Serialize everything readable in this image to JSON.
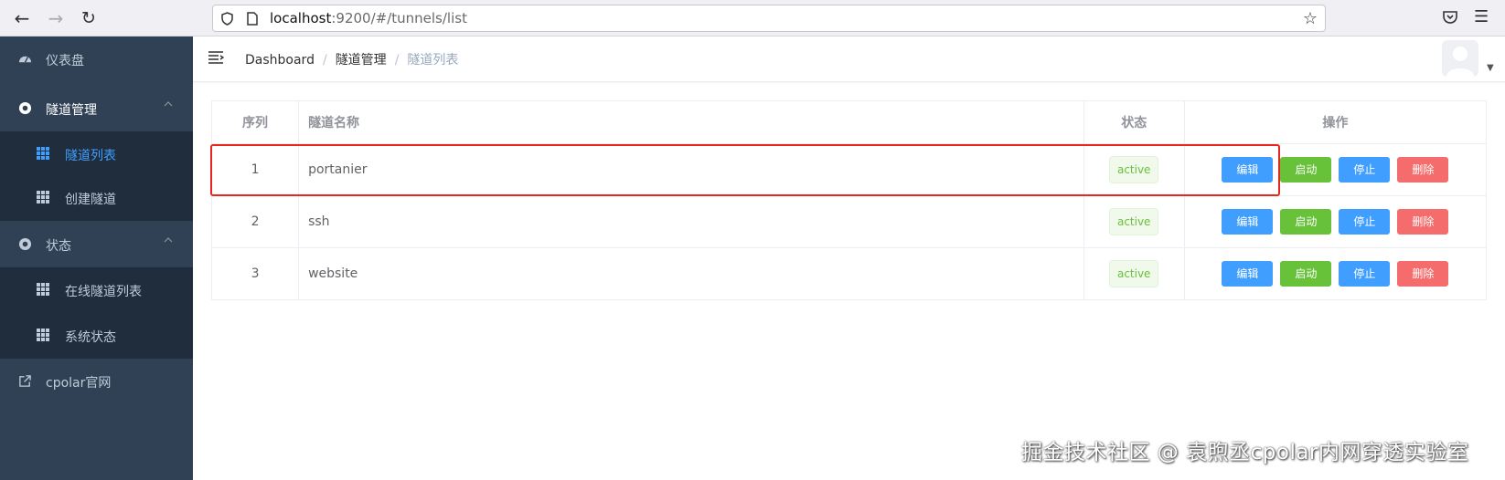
{
  "browser": {
    "url_host": "localhost",
    "url_rest": ":9200/#/tunnels/list",
    "icons": [
      "back-arrow-icon",
      "forward-arrow-icon",
      "reload-icon",
      "shield-icon",
      "page-icon",
      "star-icon",
      "pocket-icon",
      "menu-icon"
    ]
  },
  "sidebar": {
    "dashboard": "仪表盘",
    "tunnel_mgmt": "隧道管理",
    "tunnel_list": "隧道列表",
    "create_tunnel": "创建隧道",
    "status": "状态",
    "online_tunnels": "在线隧道列表",
    "system_status": "系统状态",
    "cpolar_site": "cpolar官网",
    "active_color": "#409eff"
  },
  "header": {
    "crumb_1": "Dashboard",
    "crumb_2": "隧道管理",
    "crumb_3": "隧道列表",
    "sep": "/"
  },
  "table": {
    "headers": {
      "idx": "序列",
      "name": "隧道名称",
      "status": "状态",
      "ops": "操作"
    },
    "rows": [
      {
        "idx": "1",
        "name": "portanier",
        "status": "active"
      },
      {
        "idx": "2",
        "name": "ssh",
        "status": "active"
      },
      {
        "idx": "3",
        "name": "website",
        "status": "active"
      }
    ],
    "actions": {
      "edit": "编辑",
      "start": "启动",
      "stop": "停止",
      "delete": "删除"
    }
  },
  "watermark": "掘金技术社区 @ 袁煦丞cpolar内网穿透实验室"
}
